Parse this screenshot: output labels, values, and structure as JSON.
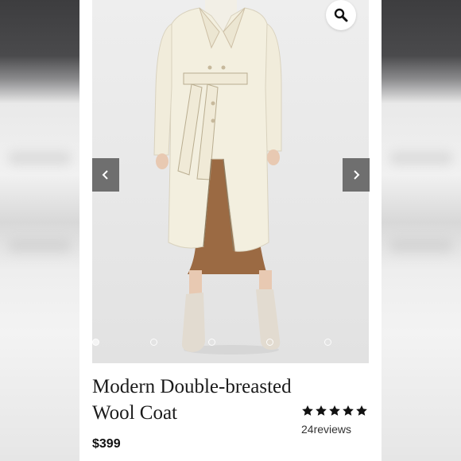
{
  "product": {
    "title": "Modern Double-breasted Wool Coat",
    "price": "$399",
    "rating": {
      "stars": 5,
      "review_count": "24",
      "review_label": "reviews"
    }
  },
  "gallery": {
    "image_count": 5,
    "active_index": 0,
    "prev_icon": "chevron-left-icon",
    "next_icon": "chevron-right-icon",
    "zoom_icon": "magnifier-icon"
  },
  "colors": {
    "nav_button_bg": "#6f6f6f",
    "star": "#111111",
    "coat": "#f3efdf",
    "skirt": "#9b6a43"
  }
}
